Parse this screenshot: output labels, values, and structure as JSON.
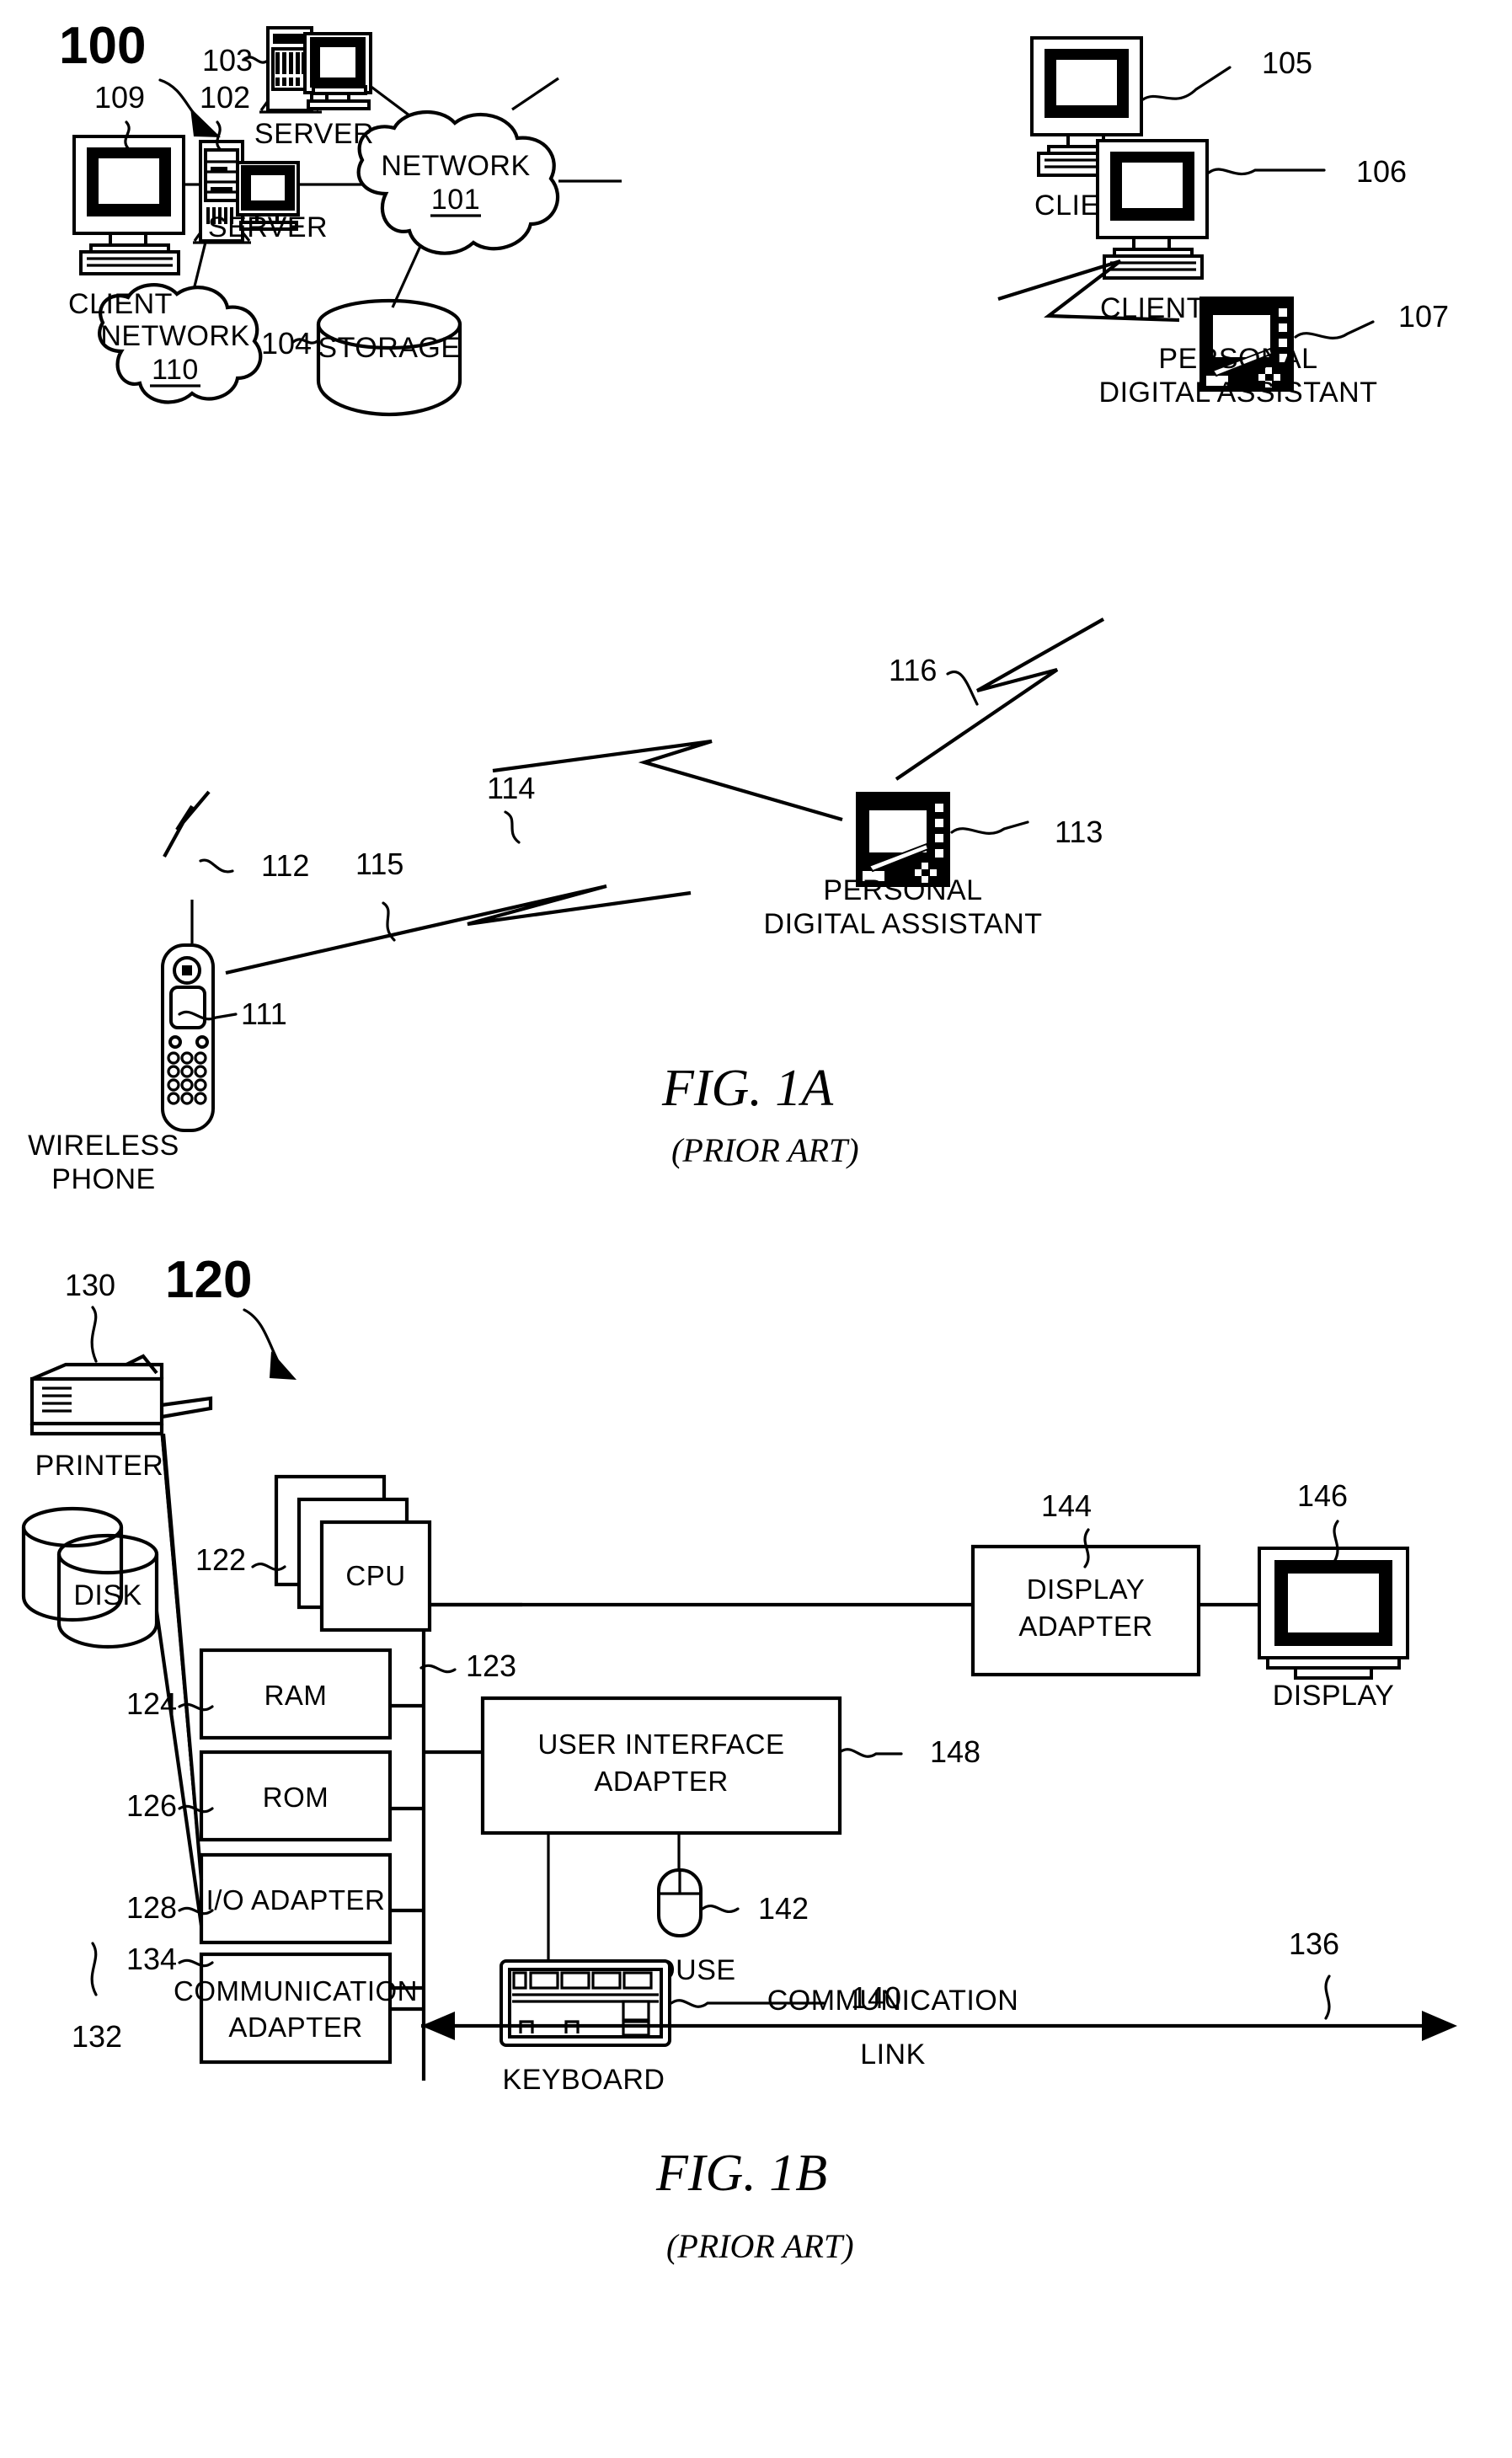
{
  "figures": [
    {
      "id": "fig1a",
      "number": "100",
      "caption": "FIG. 1A",
      "caption_note": "(PRIOR ART)",
      "nodes": {
        "network_101_label": "NETWORK",
        "network_101_ref": "101",
        "network_110_label": "NETWORK",
        "network_110_ref": "110",
        "storage_label": "STORAGE",
        "server_top_label": "SERVER",
        "server_left_label": "SERVER",
        "client_top_label": "CLIENT",
        "client_left_label": "CLIENT",
        "client_right_label": "CLIENT",
        "pda_right_line1": "PERSONAL",
        "pda_right_line2": "DIGITAL ASSISTANT",
        "pda_mid_line1": "PERSONAL",
        "pda_mid_line2": "DIGITAL ASSISTANT",
        "phone_line1": "WIRELESS",
        "phone_line2": "PHONE"
      },
      "refs": {
        "r100": "100",
        "r101": "101",
        "r102": "102",
        "r103": "103",
        "r104": "104",
        "r105": "105",
        "r106": "106",
        "r107": "107",
        "r109": "109",
        "r110": "110",
        "r111": "111",
        "r112": "112",
        "r113": "113",
        "r114": "114",
        "r115": "115",
        "r116": "116"
      }
    },
    {
      "id": "fig1b",
      "number": "120",
      "caption": "FIG. 1B",
      "caption_note": "(PRIOR ART)",
      "boxes": {
        "cpu": "CPU",
        "ram": "RAM",
        "rom": "ROM",
        "io_adapter": "I/O ADAPTER",
        "communication_adapter_line1": "COMMUNICATION",
        "communication_adapter_line2": "ADAPTER",
        "display_adapter_line1": "DISPLAY",
        "display_adapter_line2": "ADAPTER",
        "user_interface_adapter_line1": "USER INTERFACE",
        "user_interface_adapter_line2": "ADAPTER"
      },
      "devices": {
        "display": "DISPLAY",
        "mouse": "MOUSE",
        "keyboard": "KEYBOARD",
        "printer": "PRINTER",
        "disk": "DISK",
        "comm_link_line1": "COMMUNICATION",
        "comm_link_line2": "LINK"
      },
      "refs": {
        "r120": "120",
        "r122": "122",
        "r123": "123",
        "r124": "124",
        "r126": "126",
        "r128": "128",
        "r130": "130",
        "r132": "132",
        "r134": "134",
        "r136": "136",
        "r140": "140",
        "r142": "142",
        "r144": "144",
        "r146": "146",
        "r148": "148"
      }
    }
  ]
}
